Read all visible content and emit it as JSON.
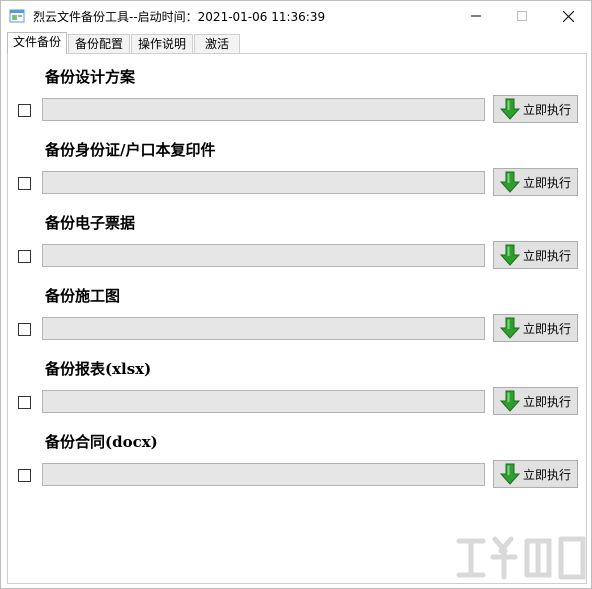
{
  "window": {
    "title": "烈云文件备份工具--启动时间：2021-01-06 11:36:39"
  },
  "tabs": [
    {
      "label": "文件备份",
      "active": true
    },
    {
      "label": "备份配置",
      "active": false
    },
    {
      "label": "操作说明",
      "active": false
    },
    {
      "label": "激活",
      "active": false
    }
  ],
  "backup_items": [
    {
      "label": "备份设计方案",
      "checked": false,
      "path": "",
      "button_label": "立即执行"
    },
    {
      "label": "备份身份证/户口本复印件",
      "checked": false,
      "path": "",
      "button_label": "立即执行"
    },
    {
      "label": "备份电子票据",
      "checked": false,
      "path": "",
      "button_label": "立即执行"
    },
    {
      "label": "备份施工图",
      "checked": false,
      "path": "",
      "button_label": "立即执行"
    },
    {
      "label": "备份报表(xlsx)",
      "checked": false,
      "path": "",
      "button_label": "立即执行"
    },
    {
      "label": "备份合同(docx)",
      "checked": false,
      "path": "",
      "button_label": "立即执行"
    }
  ],
  "icons": {
    "app": "app-window-icon",
    "run": "green-down-arrow-icon",
    "minimize": "minimize-icon",
    "maximize": "maximize-icon",
    "close": "close-icon"
  },
  "colors": {
    "arrow_green": "#2e9e2e",
    "field_bg": "#e6e6e6",
    "button_bg": "#e1e1e1"
  }
}
